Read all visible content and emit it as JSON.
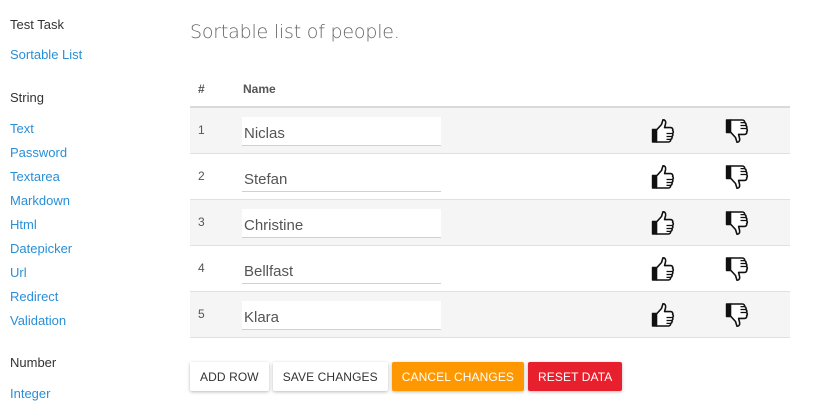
{
  "sidebar": {
    "sections": [
      {
        "heading": "Test Task",
        "links": [
          "Sortable List"
        ]
      },
      {
        "heading": "String",
        "links": [
          "Text",
          "Password",
          "Textarea",
          "Markdown",
          "Html",
          "Datepicker",
          "Url",
          "Redirect",
          "Validation"
        ]
      },
      {
        "heading": "Number",
        "links": [
          "Integer"
        ]
      }
    ]
  },
  "main": {
    "title": "Sortable list of people.",
    "table": {
      "headers": {
        "num": "#",
        "name": "Name"
      },
      "rows": [
        {
          "num": "1",
          "name": "Niclas"
        },
        {
          "num": "2",
          "name": "Stefan"
        },
        {
          "num": "3",
          "name": "Christine"
        },
        {
          "num": "4",
          "name": "Bellfast"
        },
        {
          "num": "5",
          "name": "Klara"
        }
      ]
    },
    "icons": {
      "up": "thumbs-up-icon",
      "down": "thumbs-down-icon"
    },
    "actions": {
      "add_row": "ADD ROW",
      "save_changes": "SAVE CHANGES",
      "cancel_changes": "CANCEL CHANGES",
      "reset_data": "RESET DATA"
    }
  },
  "colors": {
    "link": "#2a8fd6",
    "cancel_button": "#ff9800",
    "reset_button": "#e8202e"
  }
}
